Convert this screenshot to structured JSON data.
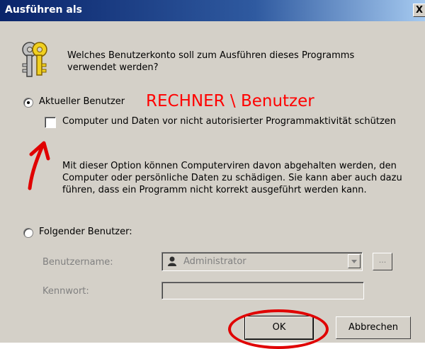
{
  "window": {
    "title": "Ausführen als",
    "close_glyph": "X"
  },
  "dialog": {
    "question": "Welches Benutzerkonto soll zum Ausführen dieses Programms verwendet werden?",
    "icon": "keys-icon",
    "current_user": {
      "label": "Aktueller Benutzer",
      "selected": true,
      "overlay_text": "RECHNER \\ Benutzer"
    },
    "protect": {
      "label": "Computer und Daten vor nicht autorisierter Programmaktivität schützen",
      "checked": false,
      "description": "Mit dieser Option können Computerviren davon abgehalten werden, den Computer oder persönliche Daten zu schädigen. Sie kann aber auch dazu führen, dass ein Programm nicht korrekt ausgeführt werden kann."
    },
    "other_user": {
      "label": "Folgender Benutzer:",
      "selected": false,
      "username_label": "Benutzername:",
      "username_value": "Administrator",
      "password_label": "Kennwort:",
      "password_value": "",
      "browse_label": "..."
    },
    "buttons": {
      "ok": "OK",
      "cancel": "Abbrechen"
    }
  },
  "annotations": {
    "color": "#e00000"
  }
}
